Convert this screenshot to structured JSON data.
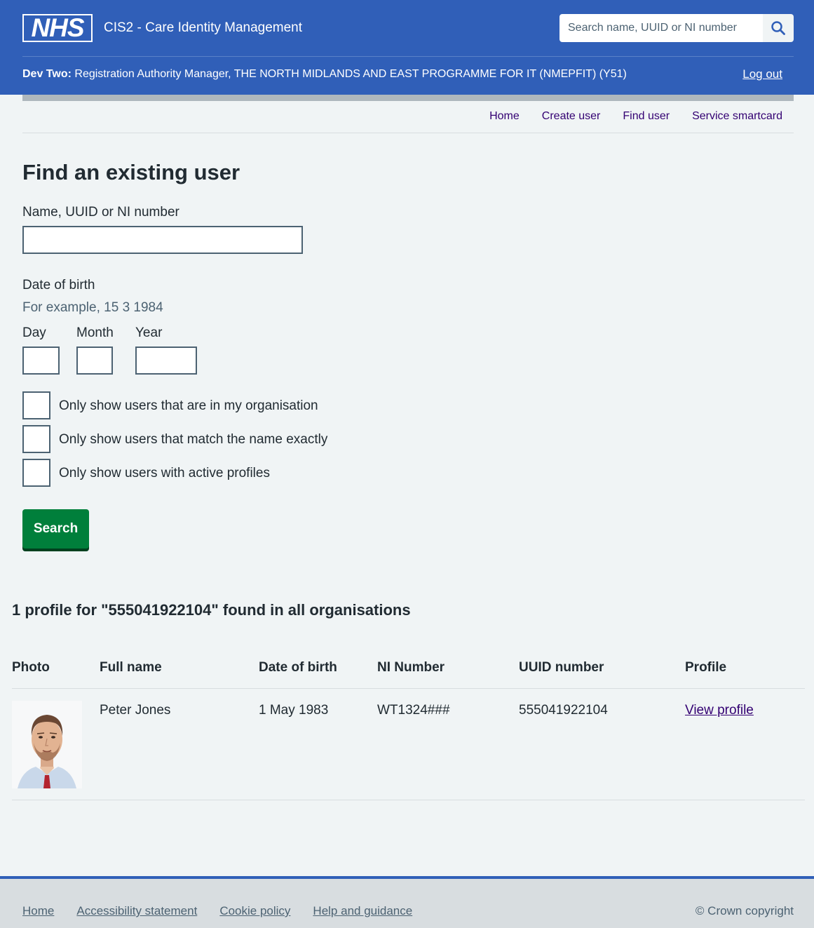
{
  "header": {
    "logo_text": "NHS",
    "service_name": "CIS2 - Care Identity Management",
    "search_placeholder": "Search name, UUID or NI number",
    "user_name": "Dev Two:",
    "user_role": "Registration Authority Manager, THE NORTH MIDLANDS AND EAST PROGRAMME FOR IT (NMEPFIT) (Y51)",
    "logout_label": "Log out",
    "brand_color": "#305fb8"
  },
  "nav": {
    "items": [
      {
        "label": "Home"
      },
      {
        "label": "Create user"
      },
      {
        "label": "Find user"
      },
      {
        "label": "Service smartcard"
      }
    ]
  },
  "form": {
    "title": "Find an existing user",
    "name_label": "Name, UUID or NI number",
    "name_value": "",
    "dob_label": "Date of birth",
    "dob_hint": "For example, 15 3 1984",
    "day_label": "Day",
    "month_label": "Month",
    "year_label": "Year",
    "checkboxes": [
      {
        "label": "Only show users that are in my organisation",
        "checked": false
      },
      {
        "label": "Only show users that match the name exactly",
        "checked": false
      },
      {
        "label": "Only show users with active profiles",
        "checked": false
      }
    ],
    "search_button": "Search",
    "button_color": "#007f3b"
  },
  "results": {
    "heading": "1 profile for \"555041922104\" found in all organisations",
    "columns": [
      "Photo",
      "Full name",
      "Date of birth",
      "NI Number",
      "UUID number",
      "Profile"
    ],
    "rows": [
      {
        "photo_icon": "user-photo",
        "full_name": "Peter Jones",
        "dob": "1 May 1983",
        "ni_number": "WT1324###",
        "uuid": "555041922104",
        "profile_link": "View profile"
      }
    ]
  },
  "footer": {
    "links": [
      "Home",
      "Accessibility statement",
      "Cookie policy",
      "Help and guidance"
    ],
    "copyright": "© Crown copyright"
  }
}
